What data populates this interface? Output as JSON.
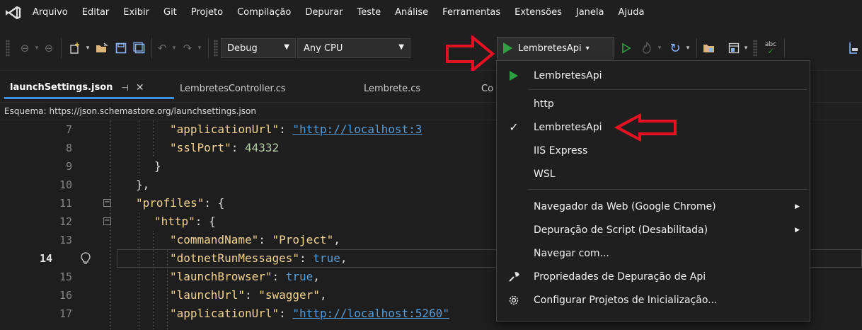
{
  "menu": {
    "items": [
      "Arquivo",
      "Editar",
      "Exibir",
      "Git",
      "Projeto",
      "Compilação",
      "Depurar",
      "Teste",
      "Análise",
      "Ferramentas",
      "Extensões",
      "Janela",
      "Ajuda"
    ]
  },
  "toolbar": {
    "config_value": "Debug",
    "platform_value": "Any CPU",
    "run_target_label": "LembretesApi",
    "spell_label": "abc",
    "icons": [
      "back-icon",
      "forward-icon",
      "new-item-icon",
      "open-folder-icon",
      "save-icon",
      "save-all-icon",
      "undo-icon",
      "redo-icon",
      "start-without-debugging-icon",
      "hot-reload-icon",
      "restart-icon",
      "solution-explorer-icon",
      "window-layout-icon",
      "spell-check-icon"
    ]
  },
  "tabs": {
    "active": "launchSettings.json",
    "others": [
      "LembretesController.cs",
      "Lembrete.cs",
      "Co"
    ]
  },
  "schema": {
    "label": "Esquema:",
    "url": "https://json.schemastore.org/launchsettings.json"
  },
  "editor": {
    "current_line": 14,
    "lines": [
      {
        "num": "7",
        "key": "\"applicationUrl\"",
        "sep": ": ",
        "value": "\"http://localhost:3",
        "value_type": "url"
      },
      {
        "num": "8",
        "key": "\"sslPort\"",
        "sep": ": ",
        "value": "44332",
        "value_type": "number"
      },
      {
        "num": "9",
        "text": "}"
      },
      {
        "num": "10",
        "text": "},"
      },
      {
        "num": "11",
        "key": "\"profiles\"",
        "sep": ": {",
        "value": "",
        "value_type": "none"
      },
      {
        "num": "12",
        "key": "\"http\"",
        "sep": ": {",
        "value": "",
        "value_type": "none"
      },
      {
        "num": "13",
        "key": "\"commandName\"",
        "sep": ": ",
        "value": "\"Project\"",
        "tail": ",",
        "value_type": "string"
      },
      {
        "num": "14",
        "key": "\"dotnetRunMessages\"",
        "sep": ": ",
        "value": "true",
        "tail": ",",
        "value_type": "bool"
      },
      {
        "num": "15",
        "key": "\"launchBrowser\"",
        "sep": ": ",
        "value": "true",
        "tail": ",",
        "value_type": "bool"
      },
      {
        "num": "16",
        "key": "\"launchUrl\"",
        "sep": ": ",
        "value": "\"swagger\"",
        "tail": ",",
        "value_type": "string"
      },
      {
        "num": "17",
        "key": "\"applicationUrl\"",
        "sep": ": ",
        "value": "\"http://localhost:5260\"",
        "value_type": "url"
      }
    ]
  },
  "dropdown": {
    "top_item": "LembretesApi",
    "profiles": [
      "http",
      "LembretesApi",
      "IIS Express",
      "WSL"
    ],
    "checked_profile": "LembretesApi",
    "browser_item": "Navegador da Web (Google Chrome)",
    "script_debug_item": "Depuração de Script (Desabilitada)",
    "browse_with_item": "Navegar com...",
    "debug_props_item": "Propriedades de Depuração de Api",
    "configure_startup_item": "Configurar Projetos de Inicialização...",
    "check_mark": "✓",
    "submenu_arrow": "▶"
  },
  "colors": {
    "accent_blue": "#3e8ede",
    "run_green": "#2ea043",
    "annotation_red": "#e81123",
    "json_key": "#f2d392",
    "json_link": "#569cd6"
  }
}
